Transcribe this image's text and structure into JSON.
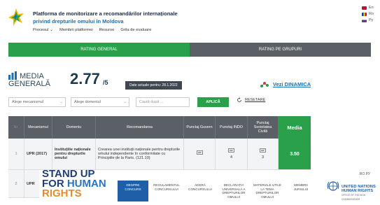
{
  "header": {
    "title_line1": "Platforma de monitorizare a recomandărilor internaționale",
    "title_line2": "privind drepturile omului în Moldova",
    "nav": [
      "Procesul ⌄",
      "Membrii platformei",
      "Resurse",
      "Grila de evaluare"
    ],
    "languages": [
      {
        "code": "En",
        "color": "#c8102e"
      },
      {
        "code": "Ro",
        "color": "#e3b200"
      },
      {
        "code": "Ру",
        "color": "#2b3fa0"
      }
    ]
  },
  "tabs": [
    {
      "label": "RATING GENERAL",
      "active": true
    },
    {
      "label": "RATING PE GRUPURI",
      "active": false
    }
  ],
  "media": {
    "label_line1": "MEDIA",
    "label_line2": "GENERALĂ",
    "score": "2.77",
    "score_denominator": "/5",
    "date_badge": "Date actuale pentru: 28.1.2022",
    "dynamic_link": "Vezi DINAMICA"
  },
  "filters": {
    "mechanism_placeholder": "Alege mecanismul",
    "domain_placeholder": "Alege domeniul",
    "search_placeholder": "Caută după ...",
    "apply_label": "APLICĂ",
    "reset_label": "RESETARE"
  },
  "table": {
    "headers": [
      "Nr.",
      "Mecanismul",
      "Domeniu",
      "Recomandarea",
      "Punctaj Guvern",
      "Punctaj INDO",
      "Punctaj Societatea Civilă",
      "Media"
    ],
    "rows": [
      {
        "nr": "1",
        "mechanism": "UPR (2017)",
        "domain": "Instituțiile naționale pentru drepturile omului",
        "recommendation": "Crearea unei instituții naționale pentru drepturile omului independente în conformitate cu Principiile de la Paris. (121.10)",
        "gov": "",
        "indo": "4",
        "civil": "3",
        "media": "3.50"
      },
      {
        "nr": "2",
        "mechanism": "UPR",
        "domain": "",
        "recommendation": "",
        "gov": "",
        "indo": "",
        "civil": "",
        "media": ""
      }
    ]
  },
  "footer": {
    "campaign_line1": "STAND UP",
    "campaign_line2_a": "FOR ",
    "campaign_line2_b": "HUMAN",
    "campaign_line3": "RIGHTS",
    "nav": [
      {
        "label": "DESPRE CONCURS",
        "active": true
      },
      {
        "label": "REGULAMENTUL CONCURSULUI",
        "active": false
      },
      {
        "label": "ADERĂ CONCURSULUI",
        "active": false
      },
      {
        "label": "DECLARAȚIA UNIVERSALĂ A DREPTURILOR OMULUI",
        "active": false
      },
      {
        "label": "MATERIALE UTILE LA TEMA DREPTURILOR OMULUI",
        "active": false
      },
      {
        "label": "MEMBRII JURIULUI",
        "active": false
      }
    ],
    "lang_links": "RO   РУ",
    "un_line1": "UNITED NATIONS",
    "un_line2": "HUMAN RIGHTS",
    "un_sub": "OFFICE OF THE HIGH COMMISSIONER"
  },
  "colors": {
    "accent_green": "#2aa04a",
    "header_gray": "#5a6066",
    "brand_blue": "#1a6fb5",
    "orange": "#e98b2a"
  }
}
